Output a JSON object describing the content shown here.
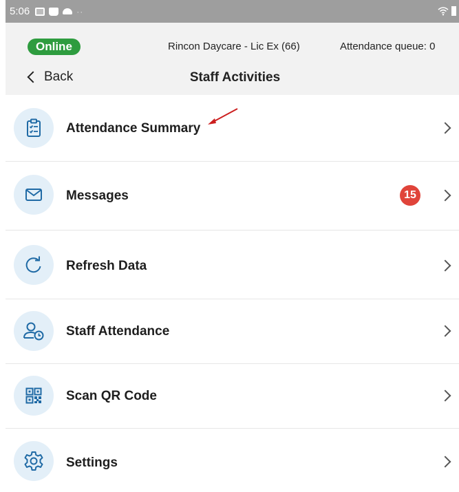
{
  "status_bar": {
    "time": "5:06",
    "icons": [
      "image-icon",
      "bag-icon",
      "cloud-icon",
      "dots-icon",
      "wifi-icon",
      "battery-icon"
    ]
  },
  "header": {
    "online_label": "Online",
    "center_name": "Rincon Daycare - Lic Ex (66)",
    "attendance_queue": "Attendance queue: 0",
    "back_label": "Back",
    "title": "Staff Activities"
  },
  "menu": {
    "items": [
      {
        "label": "Attendance Summary",
        "icon": "clipboard-checklist-icon"
      },
      {
        "label": "Messages",
        "icon": "envelope-icon",
        "badge": "15"
      },
      {
        "label": "Refresh Data",
        "icon": "refresh-icon"
      },
      {
        "label": "Staff Attendance",
        "icon": "person-clock-icon"
      },
      {
        "label": "Scan QR Code",
        "icon": "qr-code-icon"
      },
      {
        "label": "Settings",
        "icon": "gear-icon"
      }
    ]
  },
  "colors": {
    "online_green": "#2e9c3f",
    "icon_blue": "#1f6aa5",
    "icon_bg": "#e3eff8",
    "badge_red": "#e0443a",
    "annotation_arrow": "#cc1f1f"
  }
}
